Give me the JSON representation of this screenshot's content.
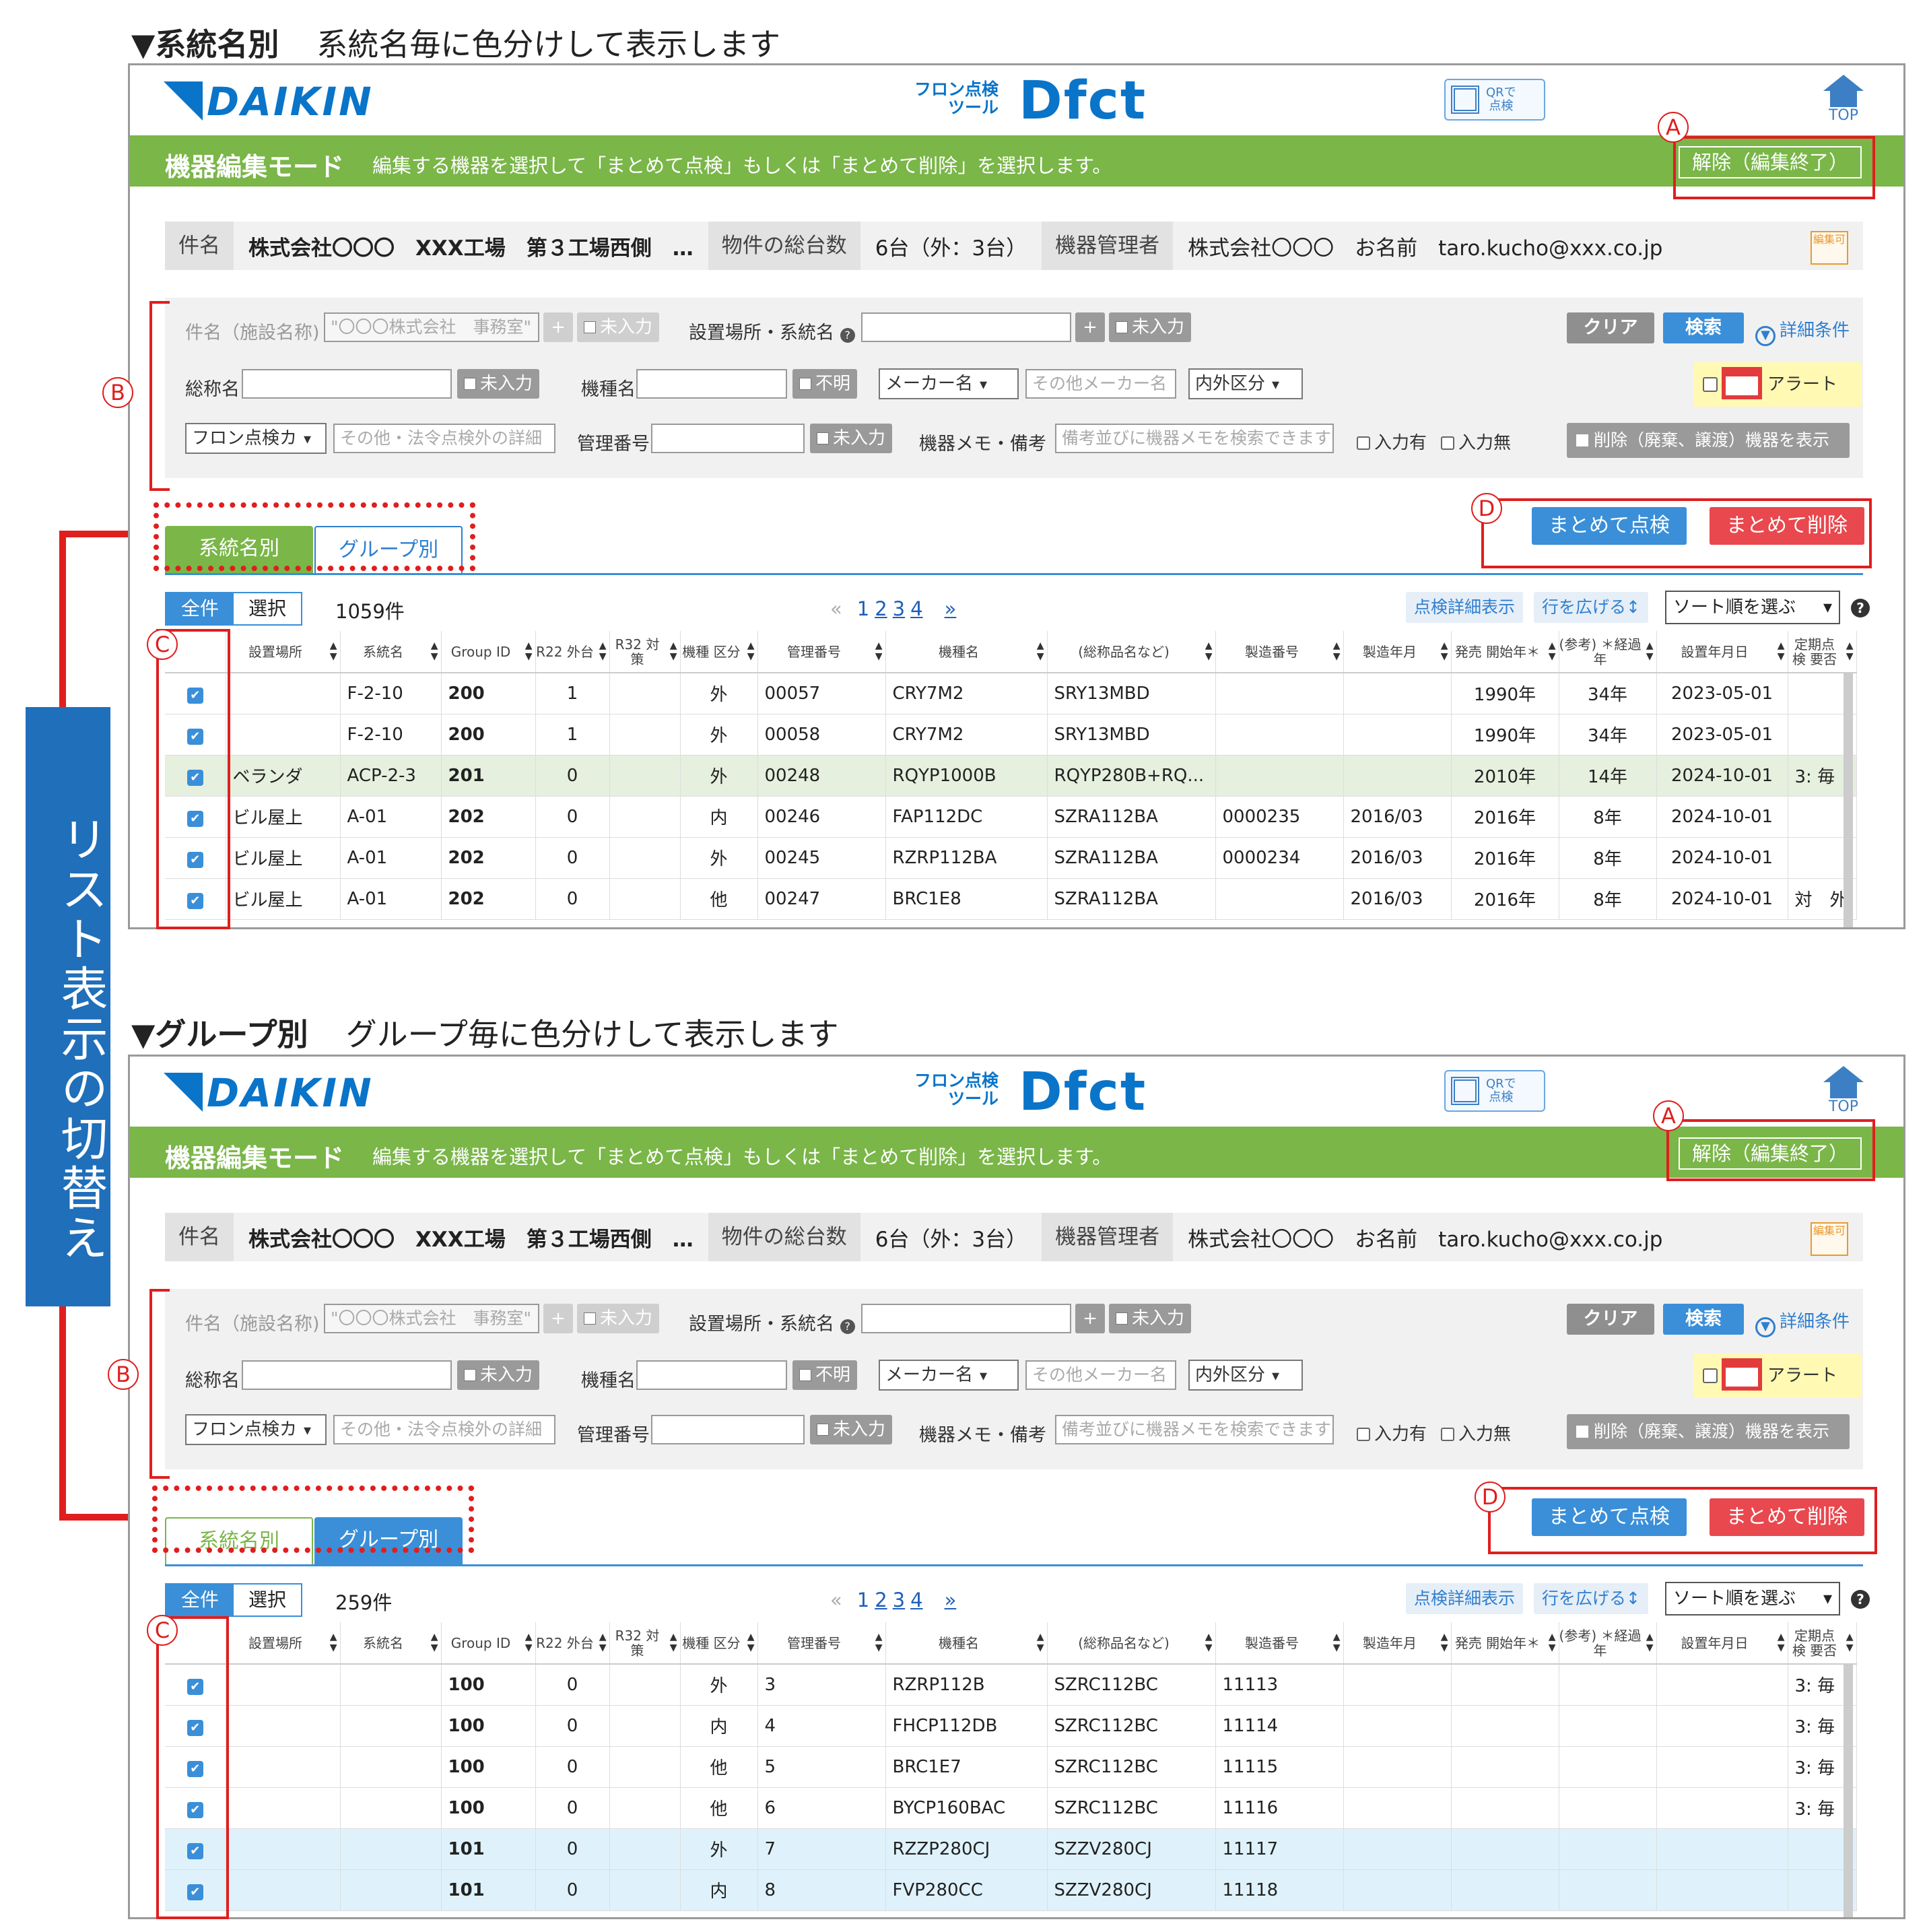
{
  "side_label": "リスト表示の切替え",
  "annotation_labels": {
    "a": "A",
    "b": "B",
    "c": "C",
    "d": "D"
  },
  "colors": {
    "accent_green": "#7ab648",
    "accent_blue": "#3a8fd8",
    "delete_red": "#e8484e",
    "annotation_red": "#e01e1e",
    "side_label_bg": "#1f6fba"
  },
  "panels": [
    {
      "heading_bold": "▼系統名別",
      "heading_text": "系統名毎に色分けして表示します",
      "app": {
        "brand": "DAIKIN",
        "tool_line1": "フロン点検",
        "tool_line2": "ツール",
        "tool_name": "Dfct",
        "qr_line1": "QRで",
        "qr_line2": "点検",
        "home_label": "TOP"
      },
      "mode_title": "機器編集モード",
      "mode_desc": "編集する機器を選択して「まとめて点検」もしくは「まとめて削除」を選択します。",
      "exit_button": "解除（編集終了）",
      "info": {
        "subject_label": "件名",
        "subject_value": "株式会社〇〇〇　XXX工場　第３工場西側　…",
        "total_label": "物件の総台数",
        "total_value": "6台（外：3台）",
        "manager_label": "機器管理者",
        "manager_value": "株式会社〇〇〇　お名前　taro.kucho@xxx.co.jp",
        "edit_icon": "編集可"
      },
      "search": {
        "facility_label": "件名（施設名称)",
        "facility_value": "\"〇〇〇株式会社　事務室\"",
        "add_symbol": "+",
        "not_entered": "未入力",
        "location_label": "設置場所・系統名",
        "help_symbol": "?",
        "product_label": "総称名",
        "model_label": "機種名",
        "unknown": "不明",
        "maker_select": "メーカー名",
        "other_maker_placeholder": "その他メーカー名",
        "inout_select": "内外区分",
        "inspection_select": "フロン点検カ",
        "inspection_detail_placeholder": "その他・法令点検外の詳細",
        "mgmt_no_label": "管理番号",
        "memo_label": "機器メモ・備考",
        "memo_placeholder": "備考並びに機器メモを検索できます",
        "has_input": "入力有",
        "no_input": "入力無",
        "clear": "クリア",
        "search": "検索",
        "advanced": "詳細条件",
        "alert": "アラート",
        "show_deleted": "削除（廃棄、譲渡）機器を表示"
      },
      "tabs": {
        "by_system": "系統名別",
        "by_group": "グループ別",
        "active": "by_system"
      },
      "bulk_inspect": "まとめて点検",
      "bulk_delete": "まとめて削除",
      "list": {
        "all": "全件",
        "selected": "選択",
        "count": "1059件",
        "pages": [
          "1",
          "2",
          "3",
          "4"
        ],
        "prev": "«",
        "next": "»",
        "detail_btn": "点検詳細表示",
        "expand_btn": "行を広げる↕",
        "sort_placeholder": "ソート順を選ぶ"
      },
      "columns": [
        "",
        "設置場所",
        "系統名",
        "Group ID",
        "R22 外台",
        "R32 対策",
        "機種 区分",
        "管理番号",
        "機種名",
        "(総称品名など)",
        "製造番号",
        "製造年月",
        "発売 開始年＊",
        "(参考) ＊経過年",
        "設置年月日",
        "定期点検 要否"
      ],
      "rows": [
        {
          "check": "✔",
          "loc": "",
          "sys": "F-2-10",
          "gid": "200",
          "r22": "1",
          "r32": "",
          "kind": "外",
          "mgmt": "00057",
          "model": "CRY7M2",
          "product": "SRY13MBD",
          "serial": "",
          "mfg": "",
          "release": "1990年",
          "elapsed": "34年",
          "install": "2023-05-01",
          "periodic": ""
        },
        {
          "check": "✔",
          "loc": "",
          "sys": "F-2-10",
          "gid": "200",
          "r22": "1",
          "r32": "",
          "kind": "外",
          "mgmt": "00058",
          "model": "CRY7M2",
          "product": "SRY13MBD",
          "serial": "",
          "mfg": "",
          "release": "1990年",
          "elapsed": "34年",
          "install": "2023-05-01",
          "periodic": ""
        },
        {
          "check": "✔",
          "loc": "ベランダ",
          "sys": "ACP-2-3",
          "gid": "201",
          "r22": "0",
          "r32": "",
          "kind": "外",
          "mgmt": "00248",
          "model": "RQYP1000B",
          "product": "RQYP280B+RQ...",
          "serial": "",
          "mfg": "",
          "release": "2010年",
          "elapsed": "14年",
          "install": "2024-10-01",
          "periodic": "3: 毎"
        },
        {
          "check": "✔",
          "loc": "ビル屋上",
          "sys": "A-01",
          "gid": "202",
          "r22": "0",
          "r32": "",
          "kind": "内",
          "mgmt": "00246",
          "model": "FAP112DC",
          "product": "SZRA112BA",
          "serial": "0000235",
          "mfg": "2016/03",
          "release": "2016年",
          "elapsed": "8年",
          "install": "2024-10-01",
          "periodic": ""
        },
        {
          "check": "✔",
          "loc": "ビル屋上",
          "sys": "A-01",
          "gid": "202",
          "r22": "0",
          "r32": "",
          "kind": "外",
          "mgmt": "00245",
          "model": "RZRP112BA",
          "product": "SZRA112BA",
          "serial": "0000234",
          "mfg": "2016/03",
          "release": "2016年",
          "elapsed": "8年",
          "install": "2024-10-01",
          "periodic": ""
        },
        {
          "check": "✔",
          "loc": "ビル屋上",
          "sys": "A-01",
          "gid": "202",
          "r22": "0",
          "r32": "",
          "kind": "他",
          "mgmt": "00247",
          "model": "BRC1E8",
          "product": "SZRA112BA",
          "serial": "",
          "mfg": "2016/03",
          "release": "2016年",
          "elapsed": "8年",
          "install": "2024-10-01",
          "periodic": "対　外"
        }
      ]
    },
    {
      "heading_bold": "▼グループ別",
      "heading_text": "グループ毎に色分けして表示します",
      "app": {
        "brand": "DAIKIN",
        "tool_line1": "フロン点検",
        "tool_line2": "ツール",
        "tool_name": "Dfct",
        "qr_line1": "QRで",
        "qr_line2": "点検",
        "home_label": "TOP"
      },
      "mode_title": "機器編集モード",
      "mode_desc": "編集する機器を選択して「まとめて点検」もしくは「まとめて削除」を選択します。",
      "exit_button": "解除（編集終了）",
      "info": {
        "subject_label": "件名",
        "subject_value": "株式会社〇〇〇　XXX工場　第３工場西側　…",
        "total_label": "物件の総台数",
        "total_value": "6台（外：3台）",
        "manager_label": "機器管理者",
        "manager_value": "株式会社〇〇〇　お名前　taro.kucho@xxx.co.jp",
        "edit_icon": "編集可"
      },
      "search": {
        "facility_label": "件名（施設名称)",
        "facility_value": "\"〇〇〇株式会社　事務室\"",
        "add_symbol": "+",
        "not_entered": "未入力",
        "location_label": "設置場所・系統名",
        "help_symbol": "?",
        "product_label": "総称名",
        "model_label": "機種名",
        "unknown": "不明",
        "maker_select": "メーカー名",
        "other_maker_placeholder": "その他メーカー名",
        "inout_select": "内外区分",
        "inspection_select": "フロン点検カ",
        "inspection_detail_placeholder": "その他・法令点検外の詳細",
        "mgmt_no_label": "管理番号",
        "memo_label": "機器メモ・備考",
        "memo_placeholder": "備考並びに機器メモを検索できます",
        "has_input": "入力有",
        "no_input": "入力無",
        "clear": "クリア",
        "search": "検索",
        "advanced": "詳細条件",
        "alert": "アラート",
        "show_deleted": "削除（廃棄、譲渡）機器を表示"
      },
      "tabs": {
        "by_system": "系統名別",
        "by_group": "グループ別",
        "active": "by_group"
      },
      "bulk_inspect": "まとめて点検",
      "bulk_delete": "まとめて削除",
      "list": {
        "all": "全件",
        "selected": "選択",
        "count": "259件",
        "pages": [
          "1",
          "2",
          "3",
          "4"
        ],
        "prev": "«",
        "next": "»",
        "detail_btn": "点検詳細表示",
        "expand_btn": "行を広げる↕",
        "sort_placeholder": "ソート順を選ぶ"
      },
      "columns": [
        "",
        "設置場所",
        "系統名",
        "Group ID",
        "R22 外台",
        "R32 対策",
        "機種 区分",
        "管理番号",
        "機種名",
        "(総称品名など)",
        "製造番号",
        "製造年月",
        "発売 開始年＊",
        "(参考) ＊経過年",
        "設置年月日",
        "定期点検 要否"
      ],
      "rows": [
        {
          "check": "✔",
          "loc": "",
          "sys": "",
          "gid": "100",
          "r22": "0",
          "r32": "",
          "kind": "外",
          "mgmt": "3",
          "model": "RZRP112B",
          "product": "SZRC112BC",
          "serial": "11113",
          "mfg": "",
          "release": "",
          "elapsed": "",
          "install": "",
          "periodic": "3: 毎"
        },
        {
          "check": "✔",
          "loc": "",
          "sys": "",
          "gid": "100",
          "r22": "0",
          "r32": "",
          "kind": "内",
          "mgmt": "4",
          "model": "FHCP112DB",
          "product": "SZRC112BC",
          "serial": "11114",
          "mfg": "",
          "release": "",
          "elapsed": "",
          "install": "",
          "periodic": "3: 毎"
        },
        {
          "check": "✔",
          "loc": "",
          "sys": "",
          "gid": "100",
          "r22": "0",
          "r32": "",
          "kind": "他",
          "mgmt": "5",
          "model": "BRC1E7",
          "product": "SZRC112BC",
          "serial": "11115",
          "mfg": "",
          "release": "",
          "elapsed": "",
          "install": "",
          "periodic": "3: 毎"
        },
        {
          "check": "✔",
          "loc": "",
          "sys": "",
          "gid": "100",
          "r22": "0",
          "r32": "",
          "kind": "他",
          "mgmt": "6",
          "model": "BYCP160BAC",
          "product": "SZRC112BC",
          "serial": "11116",
          "mfg": "",
          "release": "",
          "elapsed": "",
          "install": "",
          "periodic": "3: 毎"
        },
        {
          "check": "✔",
          "loc": "",
          "sys": "",
          "gid": "101",
          "r22": "0",
          "r32": "",
          "kind": "外",
          "mgmt": "7",
          "model": "RZZP280CJ",
          "product": "SZZV280CJ",
          "serial": "11117",
          "mfg": "",
          "release": "",
          "elapsed": "",
          "install": "",
          "periodic": ""
        },
        {
          "check": "✔",
          "loc": "",
          "sys": "",
          "gid": "101",
          "r22": "0",
          "r32": "",
          "kind": "内",
          "mgmt": "8",
          "model": "FVP280CC",
          "product": "SZZV280CJ",
          "serial": "11118",
          "mfg": "",
          "release": "",
          "elapsed": "",
          "install": "",
          "periodic": ""
        }
      ]
    }
  ]
}
